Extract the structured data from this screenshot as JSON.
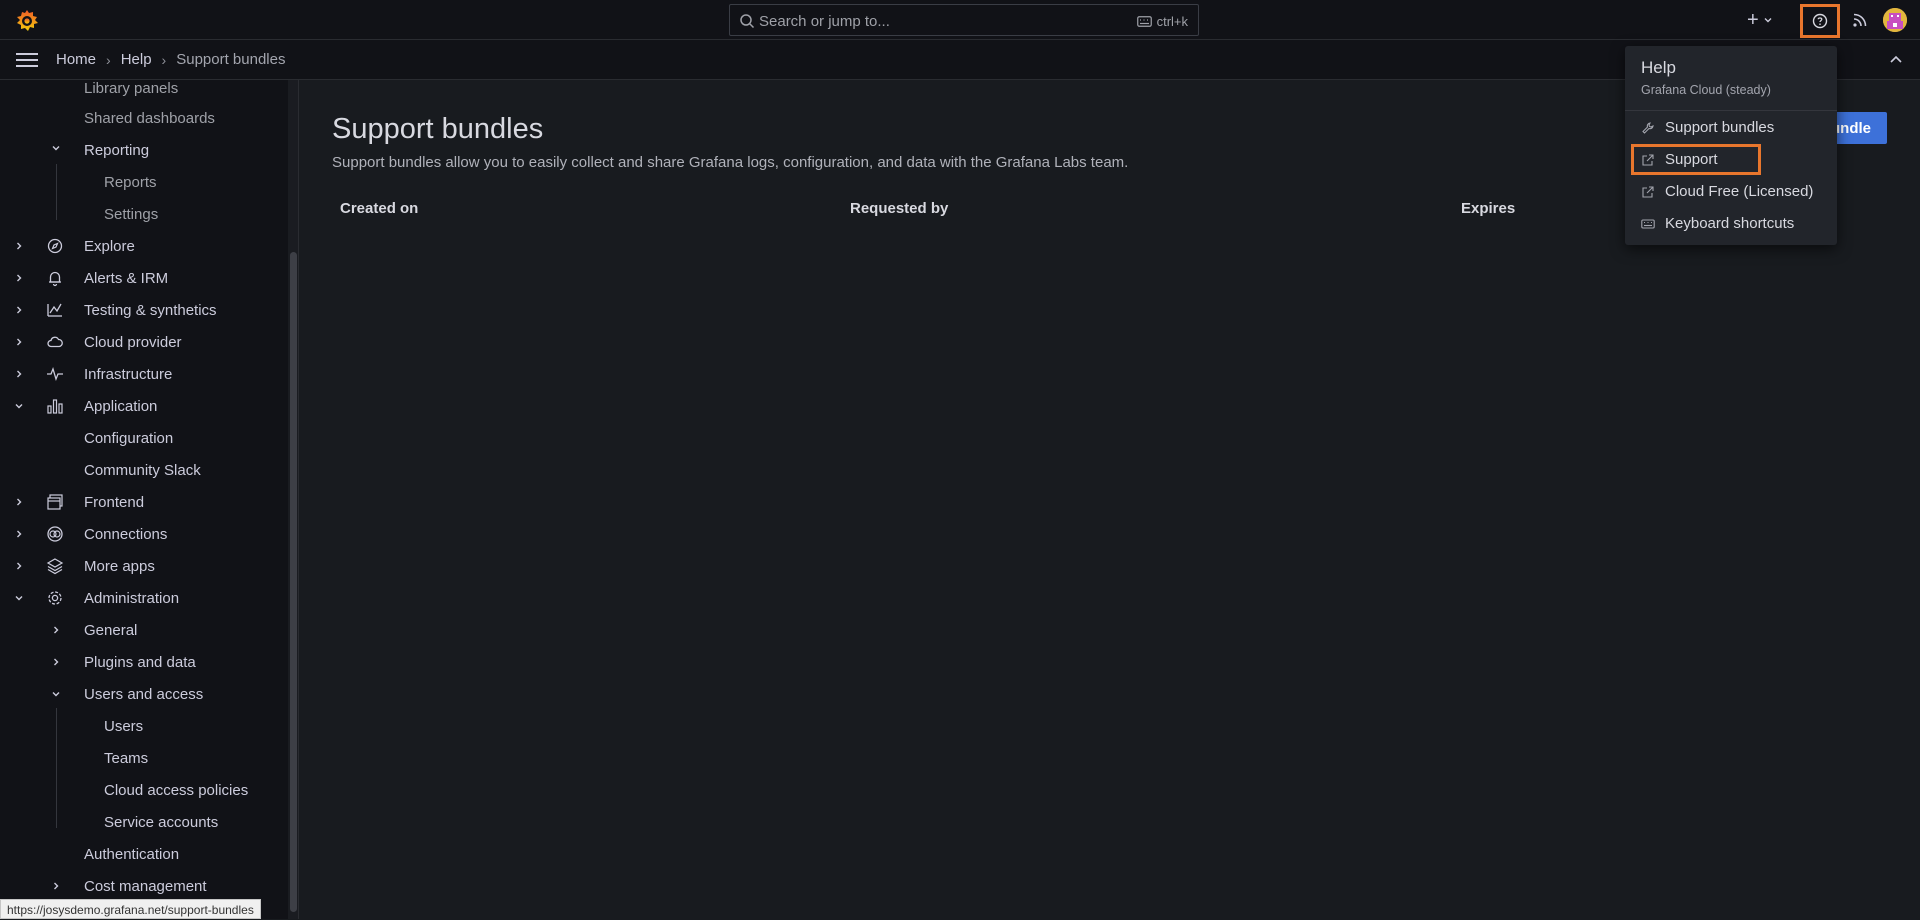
{
  "topbar": {
    "search_placeholder": "Search or jump to...",
    "search_shortcut": "ctrl+k",
    "plus_label": "+"
  },
  "breadcrumb": {
    "home": "Home",
    "help": "Help",
    "current": "Support bundles"
  },
  "sidebar": {
    "items": [
      {
        "label": "Library panels"
      },
      {
        "label": "Shared dashboards"
      },
      {
        "label": "Reporting"
      },
      {
        "label": "Reports"
      },
      {
        "label": "Settings"
      },
      {
        "label": "Explore"
      },
      {
        "label": "Alerts & IRM"
      },
      {
        "label": "Testing & synthetics"
      },
      {
        "label": "Cloud provider"
      },
      {
        "label": "Infrastructure"
      },
      {
        "label": "Application"
      },
      {
        "label": "Configuration"
      },
      {
        "label": "Community Slack"
      },
      {
        "label": "Frontend"
      },
      {
        "label": "Connections"
      },
      {
        "label": "More apps"
      },
      {
        "label": "Administration"
      },
      {
        "label": "General"
      },
      {
        "label": "Plugins and data"
      },
      {
        "label": "Users and access"
      },
      {
        "label": "Users"
      },
      {
        "label": "Teams"
      },
      {
        "label": "Cloud access policies"
      },
      {
        "label": "Service accounts"
      },
      {
        "label": "Authentication"
      },
      {
        "label": "Cost management"
      }
    ]
  },
  "statusbar": {
    "url": "https://josysdemo.grafana.net/support-bundles"
  },
  "main": {
    "title": "Support bundles",
    "description": "Support bundles allow you to easily collect and share Grafana logs, configuration, and data with the Grafana Labs team.",
    "new_button_visible_text": "undle",
    "columns": [
      "Created on",
      "Requested by",
      "Expires"
    ]
  },
  "help_menu": {
    "title": "Help",
    "subtitle": "Grafana Cloud (steady)",
    "items": [
      {
        "label": "Support bundles",
        "icon": "wrench-icon"
      },
      {
        "label": "Support",
        "icon": "external-link-icon"
      },
      {
        "label": "Cloud Free (Licensed)",
        "icon": "external-link-icon"
      },
      {
        "label": "Keyboard shortcuts",
        "icon": "keyboard-icon"
      }
    ]
  },
  "colors": {
    "highlight": "#e8762d",
    "primary": "#3d71d9",
    "background": "#181b1f",
    "panel": "#111217"
  }
}
